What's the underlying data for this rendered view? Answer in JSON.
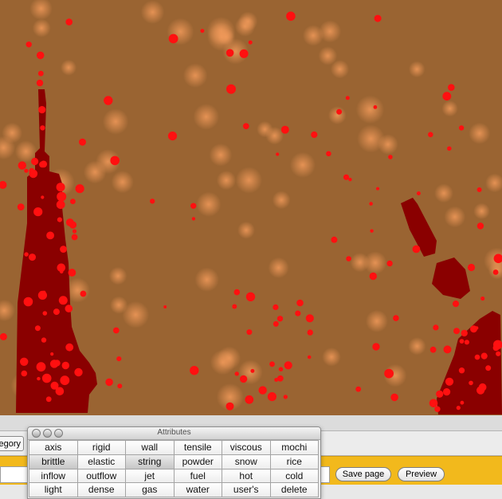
{
  "canvas": {
    "background_color": "#9a6432",
    "glow_color": "#e0894a",
    "particle_color": "#ff1010",
    "dark_shape_color": "#8a0000"
  },
  "toolbar": {
    "category_tab_label": "egory",
    "page_field_value": "",
    "save_label": "Save page",
    "preview_label": "Preview"
  },
  "attributes_panel": {
    "title": "Attributes",
    "items": [
      {
        "label": "axis",
        "selected": false
      },
      {
        "label": "rigid",
        "selected": false
      },
      {
        "label": "wall",
        "selected": false
      },
      {
        "label": "tensile",
        "selected": false
      },
      {
        "label": "viscous",
        "selected": false
      },
      {
        "label": "mochi",
        "selected": false
      },
      {
        "label": "brittle",
        "selected": true
      },
      {
        "label": "elastic",
        "selected": false
      },
      {
        "label": "string",
        "selected": true
      },
      {
        "label": "powder",
        "selected": false
      },
      {
        "label": "snow",
        "selected": false
      },
      {
        "label": "rice",
        "selected": false
      },
      {
        "label": "inflow",
        "selected": false
      },
      {
        "label": "outflow",
        "selected": false
      },
      {
        "label": "jet",
        "selected": false
      },
      {
        "label": "fuel",
        "selected": false
      },
      {
        "label": "hot",
        "selected": false
      },
      {
        "label": "cold",
        "selected": false
      },
      {
        "label": "light",
        "selected": false
      },
      {
        "label": "dense",
        "selected": false
      },
      {
        "label": "gas",
        "selected": false
      },
      {
        "label": "water",
        "selected": false
      },
      {
        "label": "user's",
        "selected": false
      },
      {
        "label": "delete",
        "selected": false
      }
    ]
  }
}
